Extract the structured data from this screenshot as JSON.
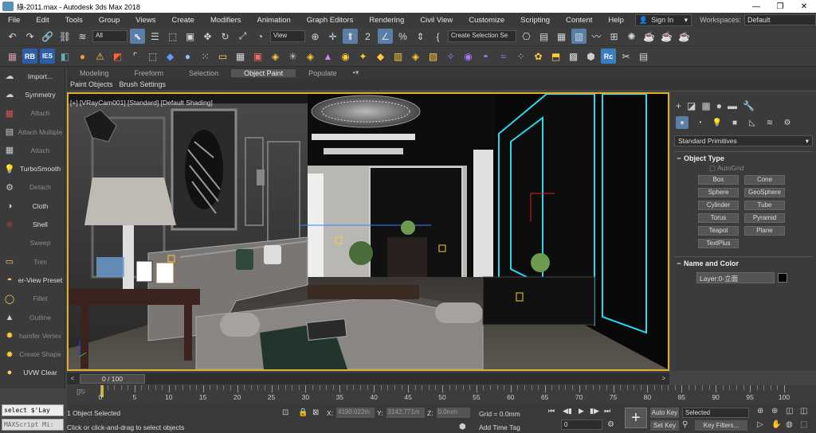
{
  "window": {
    "title": "綠-2011.max - Autodesk 3ds Max 2018",
    "min": "—",
    "max": "❐",
    "close": "✕"
  },
  "menu": [
    "File",
    "Edit",
    "Tools",
    "Group",
    "Views",
    "Create",
    "Modifiers",
    "Animation",
    "Graph Editors",
    "Rendering",
    "Civil View",
    "Customize",
    "Scripting",
    "Content",
    "Help"
  ],
  "signin": {
    "label": "Sign In",
    "arrow": "▾"
  },
  "workspace": {
    "label": "Workspaces:",
    "value": "Default"
  },
  "toolbar1": {
    "filter": "All",
    "refcoord": "View",
    "selset": "Create Selection Se"
  },
  "toolbar2": {
    "rb": "RB",
    "ies": "IES",
    "rc": "Rc"
  },
  "ribbon_tabs": [
    "Modeling",
    "Freeform",
    "Selection",
    "Object Paint",
    "Populate"
  ],
  "ribbon_active": "Object Paint",
  "ribbon_sub": [
    "Paint Objects",
    "Brush Settings"
  ],
  "left_panel": [
    {
      "label": "Import...",
      "dim": false
    },
    {
      "label": "Symmetry",
      "dim": false
    },
    {
      "label": "Attach",
      "dim": true
    },
    {
      "label": "Attach Multiple",
      "dim": true
    },
    {
      "label": "Attach",
      "dim": true
    },
    {
      "label": "TurboSmooth",
      "dim": false
    },
    {
      "label": "Detach",
      "dim": true
    },
    {
      "label": "Cloth",
      "dim": false
    },
    {
      "label": "Shell",
      "dim": false
    },
    {
      "label": "Sweep",
      "dim": true
    },
    {
      "label": "Trim",
      "dim": true
    },
    {
      "label": "er-View Preset",
      "dim": false
    },
    {
      "label": "Fillet",
      "dim": true
    },
    {
      "label": "Outline",
      "dim": true
    },
    {
      "label": "hamfer Vertex",
      "dim": true
    },
    {
      "label": "Create Shape",
      "dim": true
    },
    {
      "label": "UVW Clear",
      "dim": false
    }
  ],
  "viewport": {
    "label": "[+] [VRayCam001] [Standard] [Default Shading]"
  },
  "command_panel": {
    "dropdown": "Standard Primitives",
    "object_type_title": "Object Type",
    "autogrid": "AutoGrid",
    "buttons": [
      "Box",
      "Cone",
      "Sphere",
      "GeoSphere",
      "Cylinder",
      "Tube",
      "Torus",
      "Pyramid",
      "Teapot",
      "Plane",
      "TextPlus"
    ],
    "name_color_title": "Name and Color",
    "name_value": "Layer:0-立面"
  },
  "timeslider": {
    "thumb": "0 / 100",
    "prev": "<",
    "next": ">"
  },
  "trackbar": {
    "ticks": [
      0,
      5,
      10,
      15,
      20,
      25,
      30,
      35,
      40,
      45,
      50,
      55,
      60,
      65,
      70,
      75,
      80,
      85,
      90,
      95,
      100
    ]
  },
  "maxscript": {
    "line1": "select $'Lay",
    "line2": "MAXScript Mi:"
  },
  "status": {
    "selected": "1 Object Selected",
    "hint": "Click or click-and-drag to select objects",
    "x_label": "X:",
    "x_value": "4190.022m",
    "y_label": "Y:",
    "y_value": "3142.771m",
    "z_label": "Z:",
    "z_value": "0.0mm",
    "grid": "Grid = 0.0mm",
    "add_time_tag": "Add Time Tag",
    "frame": "0",
    "auto_key": "Auto Key",
    "set_key": "Set Key",
    "selected_dd": "Selected",
    "key_filters": "Key Filters..."
  },
  "colors": {
    "accent": "#5a7ea5",
    "viewport_border": "#d9b233",
    "selection_glow": "#29d9f0"
  }
}
